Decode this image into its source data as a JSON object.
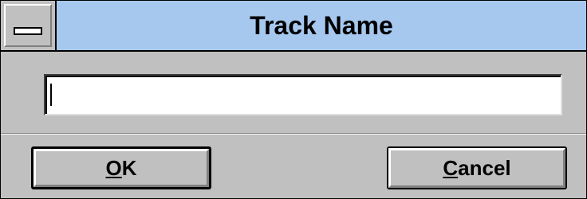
{
  "dialog": {
    "title": "Track Name",
    "track_name_value": "",
    "ok_button": {
      "mnemonic": "O",
      "rest": "K"
    },
    "cancel_button": {
      "mnemonic": "C",
      "rest": "ancel"
    }
  },
  "colors": {
    "titlebar": "#a6c8ef",
    "face": "#c0c0c0"
  }
}
